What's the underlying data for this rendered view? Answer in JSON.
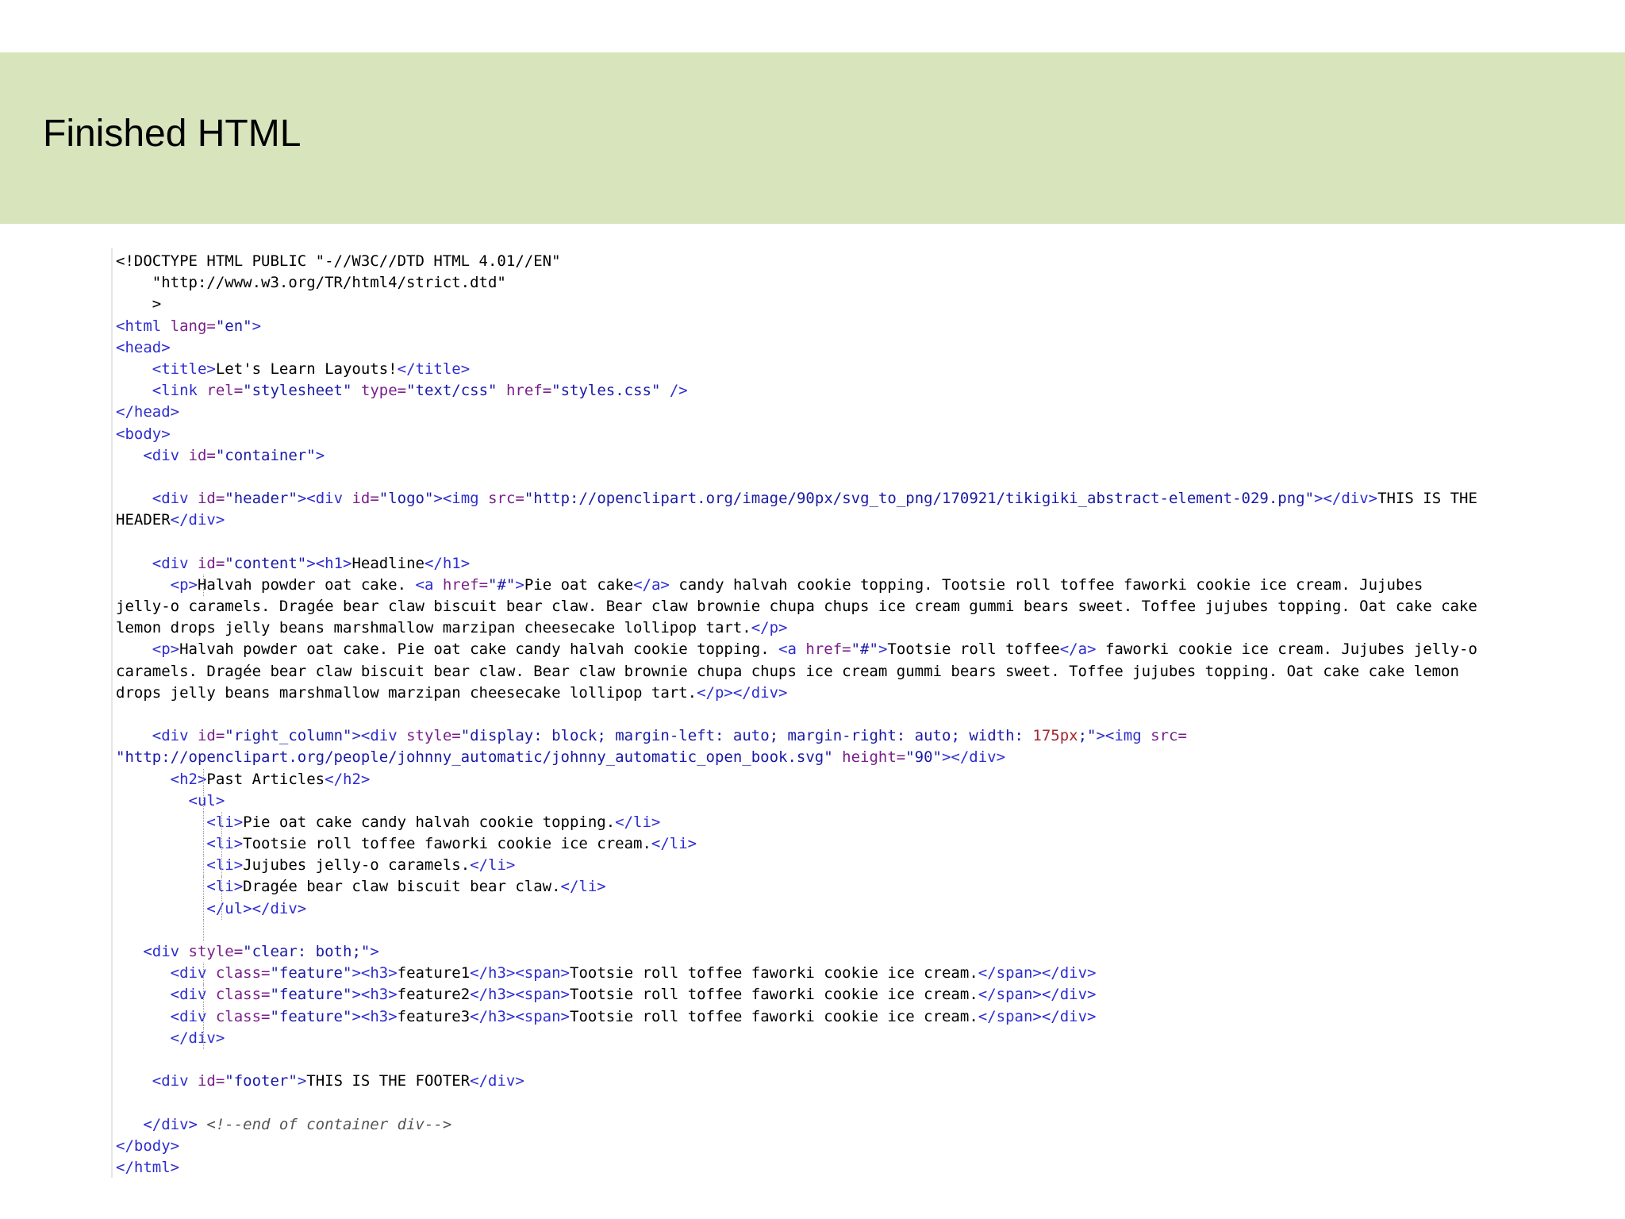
{
  "slide": {
    "title": "Finished HTML"
  },
  "code": {
    "lines": [
      [
        {
          "k": "p",
          "s": "<!DOCTYPE HTML PUBLIC \"-//W3C//DTD HTML 4.01//EN\""
        }
      ],
      [
        {
          "k": "p",
          "s": "    \"http://www.w3.org/TR/html4/strict.dtd\""
        }
      ],
      [
        {
          "k": "p",
          "s": "    >"
        }
      ],
      [
        {
          "k": "t",
          "s": "<html "
        },
        {
          "k": "a",
          "s": "lang="
        },
        {
          "k": "v",
          "s": "\"en\""
        },
        {
          "k": "t",
          "s": ">"
        }
      ],
      [
        {
          "k": "t",
          "s": "<head>"
        }
      ],
      [
        {
          "k": "p",
          "s": "    "
        },
        {
          "k": "t",
          "s": "<title>"
        },
        {
          "k": "p",
          "s": "Let's Learn Layouts!"
        },
        {
          "k": "t",
          "s": "</title>"
        }
      ],
      [
        {
          "k": "p",
          "s": "    "
        },
        {
          "k": "t",
          "s": "<link "
        },
        {
          "k": "a",
          "s": "rel="
        },
        {
          "k": "v",
          "s": "\"stylesheet\" "
        },
        {
          "k": "a",
          "s": "type="
        },
        {
          "k": "v",
          "s": "\"text/css\" "
        },
        {
          "k": "a",
          "s": "href="
        },
        {
          "k": "v",
          "s": "\"styles.css\" "
        },
        {
          "k": "t",
          "s": "/>"
        }
      ],
      [
        {
          "k": "t",
          "s": "</head>"
        }
      ],
      [
        {
          "k": "t",
          "s": "<body>"
        }
      ],
      [
        {
          "k": "p",
          "s": "   "
        },
        {
          "k": "t",
          "s": "<div "
        },
        {
          "k": "a",
          "s": "id="
        },
        {
          "k": "v",
          "s": "\"container\""
        },
        {
          "k": "t",
          "s": ">"
        }
      ],
      [],
      [
        {
          "k": "p",
          "s": "    "
        },
        {
          "k": "t",
          "s": "<div "
        },
        {
          "k": "a",
          "s": "id="
        },
        {
          "k": "v",
          "s": "\"header\""
        },
        {
          "k": "t",
          "s": "><div "
        },
        {
          "k": "a",
          "s": "id="
        },
        {
          "k": "v",
          "s": "\"logo\""
        },
        {
          "k": "t",
          "s": "><img "
        },
        {
          "k": "a",
          "s": "src="
        },
        {
          "k": "v",
          "s": "\"http://openclipart.org/image/90px/svg_to_png/170921/tikigiki_abstract-element-029.png\""
        },
        {
          "k": "t",
          "s": "></div>"
        },
        {
          "k": "p",
          "s": "THIS IS THE"
        }
      ],
      [
        {
          "k": "p",
          "s": "HEADER"
        },
        {
          "k": "t",
          "s": "</div>"
        }
      ],
      [],
      [
        {
          "k": "p",
          "s": "    "
        },
        {
          "k": "t",
          "s": "<div "
        },
        {
          "k": "a",
          "s": "id="
        },
        {
          "k": "v",
          "s": "\"content\""
        },
        {
          "k": "t",
          "s": "><h1>"
        },
        {
          "k": "p",
          "s": "Headline"
        },
        {
          "k": "t",
          "s": "</h1>"
        }
      ],
      [
        {
          "k": "p",
          "s": "      "
        },
        {
          "k": "t",
          "s": "<p>"
        },
        {
          "k": "p",
          "s": "Halvah powder oat cake. "
        },
        {
          "k": "t",
          "s": "<a "
        },
        {
          "k": "a",
          "s": "href="
        },
        {
          "k": "v",
          "s": "\"#\""
        },
        {
          "k": "t",
          "s": ">"
        },
        {
          "k": "p",
          "s": "Pie oat cake"
        },
        {
          "k": "t",
          "s": "</a>"
        },
        {
          "k": "p",
          "s": " candy halvah cookie topping. Tootsie roll toffee faworki cookie ice cream. Jujubes"
        }
      ],
      [
        {
          "k": "p",
          "s": "jelly-o caramels. Dragée bear claw biscuit bear claw. Bear claw brownie chupa chups ice cream gummi bears sweet. Toffee jujubes topping. Oat cake cake"
        }
      ],
      [
        {
          "k": "p",
          "s": "lemon drops jelly beans marshmallow marzipan cheesecake lollipop tart."
        },
        {
          "k": "t",
          "s": "</p>"
        }
      ],
      [
        {
          "k": "p",
          "s": "    "
        },
        {
          "k": "t",
          "s": "<p>"
        },
        {
          "k": "p",
          "s": "Halvah powder oat cake. Pie oat cake candy halvah cookie topping. "
        },
        {
          "k": "t",
          "s": "<a "
        },
        {
          "k": "a",
          "s": "href="
        },
        {
          "k": "v",
          "s": "\"#\""
        },
        {
          "k": "t",
          "s": ">"
        },
        {
          "k": "p",
          "s": "Tootsie roll toffee"
        },
        {
          "k": "t",
          "s": "</a>"
        },
        {
          "k": "p",
          "s": " faworki cookie ice cream. Jujubes jelly-o"
        }
      ],
      [
        {
          "k": "p",
          "s": "caramels. Dragée bear claw biscuit bear claw. Bear claw brownie chupa chups ice cream gummi bears sweet. Toffee jujubes topping. Oat cake cake lemon"
        }
      ],
      [
        {
          "k": "p",
          "s": "drops jelly beans marshmallow marzipan cheesecake lollipop tart."
        },
        {
          "k": "t",
          "s": "</p></div>"
        }
      ],
      [],
      [
        {
          "k": "p",
          "s": "    "
        },
        {
          "k": "t",
          "s": "<div "
        },
        {
          "k": "a",
          "s": "id="
        },
        {
          "k": "v",
          "s": "\"right_column\""
        },
        {
          "k": "t",
          "s": "><div "
        },
        {
          "k": "a",
          "s": "style="
        },
        {
          "k": "v",
          "s": "\"display: block; margin-left: auto; margin-right: auto; width: "
        },
        {
          "k": "num",
          "s": "175px"
        },
        {
          "k": "v",
          "s": ";\""
        },
        {
          "k": "t",
          "s": "><img "
        },
        {
          "k": "a",
          "s": "src="
        }
      ],
      [
        {
          "k": "v",
          "s": "\"http://openclipart.org/people/johnny_automatic/johnny_automatic_open_book.svg\" "
        },
        {
          "k": "a",
          "s": "height="
        },
        {
          "k": "v",
          "s": "\"90\""
        },
        {
          "k": "t",
          "s": "></div>"
        }
      ],
      [
        {
          "k": "p",
          "s": "      "
        },
        {
          "k": "t",
          "s": "<h2>"
        },
        {
          "k": "p",
          "s": "Past Articles"
        },
        {
          "k": "t",
          "s": "</h2>"
        }
      ],
      [
        {
          "k": "p",
          "s": "        "
        },
        {
          "k": "t",
          "s": "<ul>"
        }
      ],
      [
        {
          "k": "p",
          "s": "          "
        },
        {
          "k": "t",
          "s": "<li>"
        },
        {
          "k": "p",
          "s": "Pie oat cake candy halvah cookie topping."
        },
        {
          "k": "t",
          "s": "</li>"
        }
      ],
      [
        {
          "k": "p",
          "s": "          "
        },
        {
          "k": "t",
          "s": "<li>"
        },
        {
          "k": "p",
          "s": "Tootsie roll toffee faworki cookie ice cream."
        },
        {
          "k": "t",
          "s": "</li>"
        }
      ],
      [
        {
          "k": "p",
          "s": "          "
        },
        {
          "k": "t",
          "s": "<li>"
        },
        {
          "k": "p",
          "s": "Jujubes jelly-o caramels."
        },
        {
          "k": "t",
          "s": "</li>"
        }
      ],
      [
        {
          "k": "p",
          "s": "          "
        },
        {
          "k": "t",
          "s": "<li>"
        },
        {
          "k": "p",
          "s": "Dragée bear claw biscuit bear claw."
        },
        {
          "k": "t",
          "s": "</li>"
        }
      ],
      [
        {
          "k": "p",
          "s": "          "
        },
        {
          "k": "t",
          "s": "</ul></div>"
        }
      ],
      [],
      [
        {
          "k": "p",
          "s": "   "
        },
        {
          "k": "t",
          "s": "<div "
        },
        {
          "k": "a",
          "s": "style="
        },
        {
          "k": "v",
          "s": "\"clear: both;\""
        },
        {
          "k": "t",
          "s": ">"
        }
      ],
      [
        {
          "k": "p",
          "s": "      "
        },
        {
          "k": "t",
          "s": "<div "
        },
        {
          "k": "a",
          "s": "class="
        },
        {
          "k": "v",
          "s": "\"feature\""
        },
        {
          "k": "t",
          "s": "><h3>"
        },
        {
          "k": "p",
          "s": "feature1"
        },
        {
          "k": "t",
          "s": "</h3><span>"
        },
        {
          "k": "p",
          "s": "Tootsie roll toffee faworki cookie ice cream."
        },
        {
          "k": "t",
          "s": "</span></div>"
        }
      ],
      [
        {
          "k": "p",
          "s": "      "
        },
        {
          "k": "t",
          "s": "<div "
        },
        {
          "k": "a",
          "s": "class="
        },
        {
          "k": "v",
          "s": "\"feature\""
        },
        {
          "k": "t",
          "s": "><h3>"
        },
        {
          "k": "p",
          "s": "feature2"
        },
        {
          "k": "t",
          "s": "</h3><span>"
        },
        {
          "k": "p",
          "s": "Tootsie roll toffee faworki cookie ice cream."
        },
        {
          "k": "t",
          "s": "</span></div>"
        }
      ],
      [
        {
          "k": "p",
          "s": "      "
        },
        {
          "k": "t",
          "s": "<div "
        },
        {
          "k": "a",
          "s": "class="
        },
        {
          "k": "v",
          "s": "\"feature\""
        },
        {
          "k": "t",
          "s": "><h3>"
        },
        {
          "k": "p",
          "s": "feature3"
        },
        {
          "k": "t",
          "s": "</h3><span>"
        },
        {
          "k": "p",
          "s": "Tootsie roll toffee faworki cookie ice cream."
        },
        {
          "k": "t",
          "s": "</span></div>"
        }
      ],
      [
        {
          "k": "p",
          "s": "      "
        },
        {
          "k": "t",
          "s": "</div>"
        }
      ],
      [],
      [
        {
          "k": "p",
          "s": "    "
        },
        {
          "k": "t",
          "s": "<div "
        },
        {
          "k": "a",
          "s": "id="
        },
        {
          "k": "v",
          "s": "\"footer\""
        },
        {
          "k": "t",
          "s": ">"
        },
        {
          "k": "p",
          "s": "THIS IS THE FOOTER"
        },
        {
          "k": "t",
          "s": "</div>"
        }
      ],
      [],
      [
        {
          "k": "p",
          "s": "   "
        },
        {
          "k": "t",
          "s": "</div> "
        },
        {
          "k": "c",
          "s": "<!--end of container div-->"
        }
      ],
      [
        {
          "k": "t",
          "s": "</body>"
        }
      ],
      [
        {
          "k": "t",
          "s": "</html>"
        }
      ]
    ]
  }
}
